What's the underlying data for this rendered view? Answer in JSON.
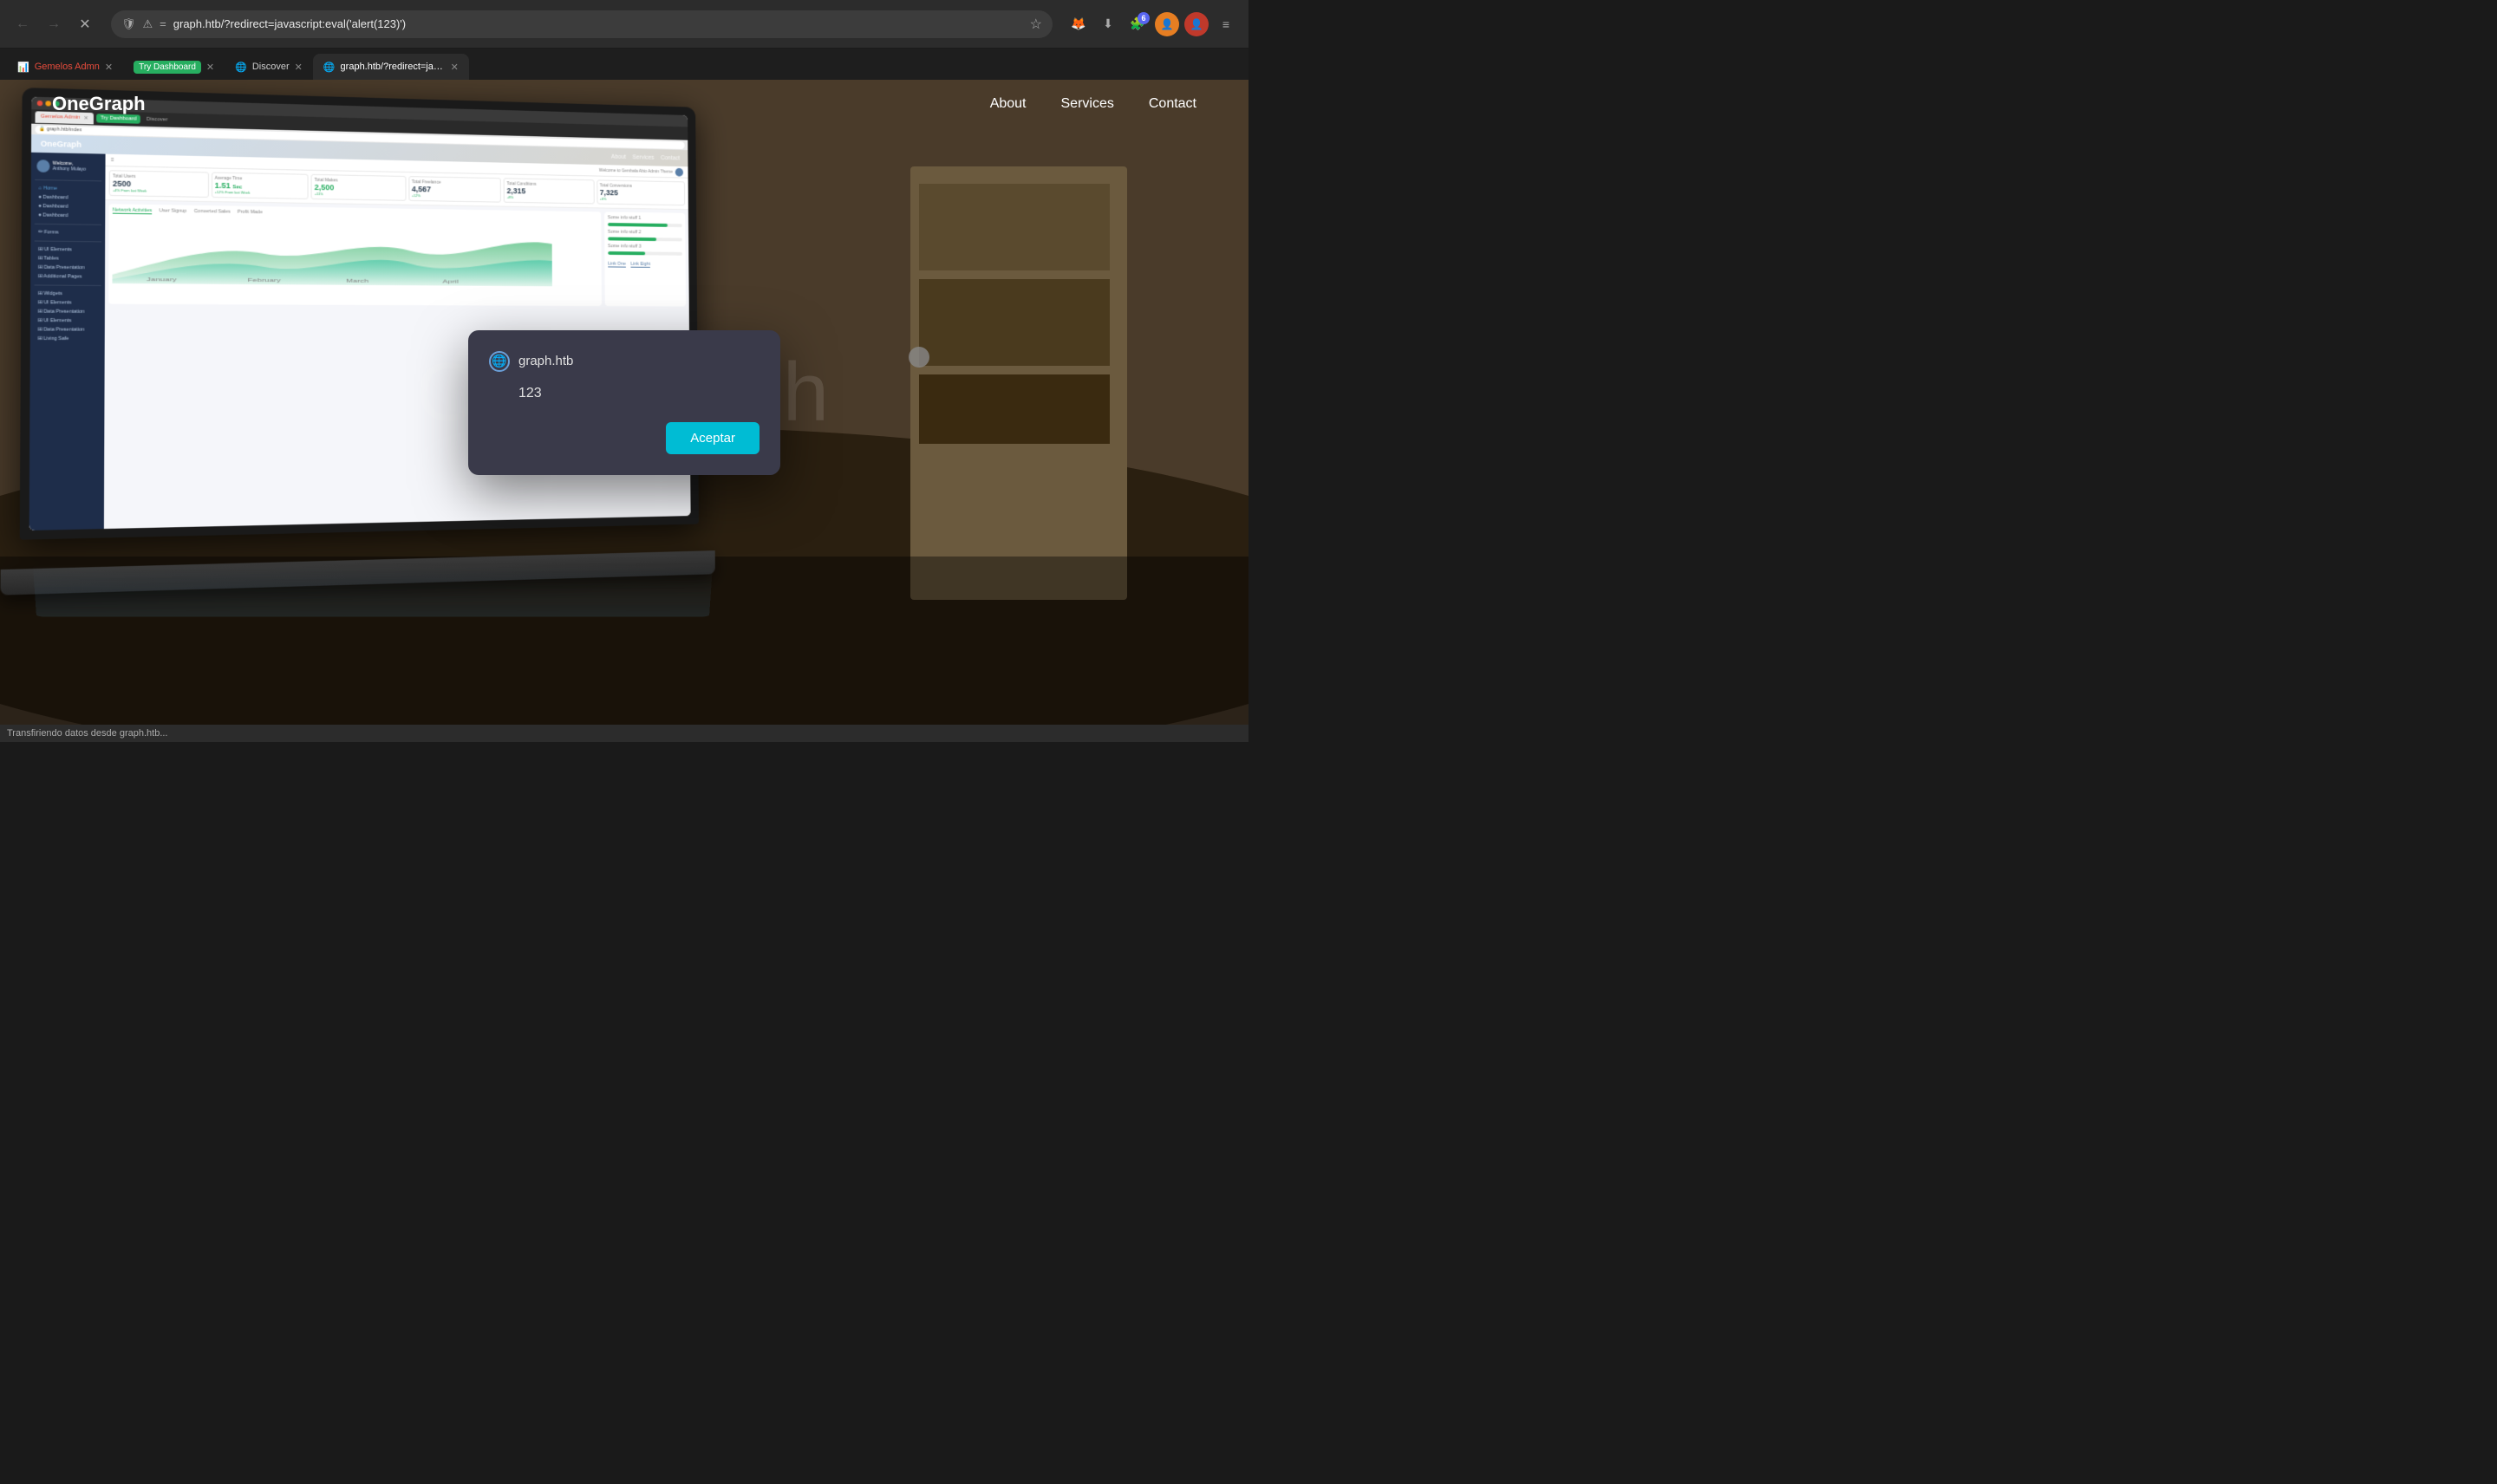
{
  "browser": {
    "back_title": "Back",
    "forward_title": "Forward",
    "reload_title": "Reload",
    "url": "graph.htb/?redirect=javascript:eval('alert(123)')",
    "tabs": [
      {
        "label": "Gemelos Admn",
        "active": false,
        "colored": true
      },
      {
        "label": "Try Dashboard",
        "active": false,
        "badge_color": "green"
      },
      {
        "label": "Discover",
        "active": false
      },
      {
        "label": "graph.htb/?redirect=javascript:eval...",
        "active": true
      }
    ],
    "badge_count": "6",
    "status_text": "Transfiriendo datos desde graph.htb..."
  },
  "site": {
    "logo": "OneGraph",
    "nav": {
      "about": "About",
      "services": "Services",
      "contact": "Contact"
    },
    "hero_text": "OneGraph"
  },
  "alert": {
    "domain": "graph.htb",
    "message": "123",
    "accept_label": "Aceptar",
    "domain_icon": "🌐"
  },
  "dashboard": {
    "logo": "OneGraph",
    "user": "Anthony Mulayo",
    "welcome": "Welcome,",
    "stats": [
      {
        "label": "Total Users",
        "value": "2500",
        "sub": "+4% From last Week"
      },
      {
        "label": "Average Time",
        "value": "1.51",
        "unit": "Sec",
        "sub": "+12% From last Week"
      },
      {
        "label": "Total Makes",
        "value": "2,500",
        "sub": "+11% From last Week"
      },
      {
        "label": "Total Freelance",
        "value": "4,567",
        "sub": "+12% From last Week"
      },
      {
        "label": "Total Conditions",
        "value": "2,315",
        "sub": "+8% From last Week"
      },
      {
        "label": "Total Conversions",
        "value": "7,325",
        "sub": "+6% From last Week"
      }
    ],
    "sidebar_items": [
      "Home",
      "Dashboard",
      "Dashboard",
      "Dashboard",
      "Forms",
      "UI Elements",
      "Tables",
      "Data Presentation",
      "Additional Pages"
    ]
  }
}
